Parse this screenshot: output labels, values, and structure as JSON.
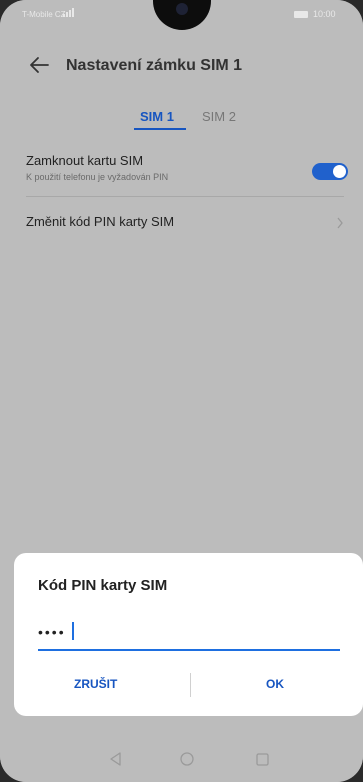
{
  "status_bar": {
    "carrier": "T-Mobile CZ",
    "time": "10:00"
  },
  "header": {
    "title": "Nastavení zámku SIM 1"
  },
  "tabs": [
    {
      "label": "SIM 1",
      "active": true
    },
    {
      "label": "SIM 2",
      "active": false
    }
  ],
  "settings": {
    "lock_sim": {
      "label": "Zamknout kartu SIM",
      "subtitle": "K použití telefonu je vyžadován PIN",
      "enabled": true
    },
    "change_pin": {
      "label": "Změnit kód PIN karty SIM"
    }
  },
  "dialog": {
    "title": "Kód PIN karty SIM",
    "pin_value": "••••",
    "cancel_label": "ZRUŠIT",
    "ok_label": "OK"
  },
  "colors": {
    "accent": "#1755c0",
    "toggle": "#2061cc",
    "dim_background": "#bcbcbc"
  },
  "icons": {
    "back": "arrow-left-icon",
    "chevron": "chevron-right-icon",
    "nav_back": "triangle-back-icon",
    "nav_home": "circle-home-icon",
    "nav_recents": "square-recents-icon"
  }
}
